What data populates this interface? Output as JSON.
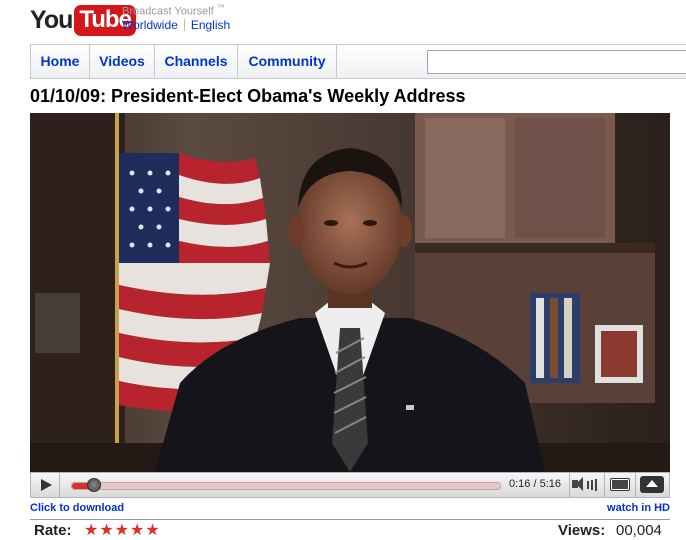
{
  "header": {
    "logo_you": "You",
    "logo_tube": "Tube",
    "tagline": "Broadcast Yourself",
    "tagline_mark": "™",
    "locale_region": "Worldwide",
    "locale_language": "English"
  },
  "nav": {
    "tabs": [
      {
        "label": "Home"
      },
      {
        "label": "Videos"
      },
      {
        "label": "Channels"
      },
      {
        "label": "Community"
      }
    ],
    "search_value": ""
  },
  "video": {
    "title": "01/10/09: President-Elect Obama's Weekly Address",
    "progress_fraction": 0.051,
    "time_display": "0:16 / 5:16",
    "download_link": "Click to download",
    "hd_link": "watch in HD"
  },
  "stats": {
    "rate_label": "Rate:",
    "stars": "★★★★★",
    "views_label": "Views:",
    "views_value": "00,004"
  },
  "colors": {
    "brand_red": "#d5161b",
    "link_blue": "#0033cc",
    "progress_red": "#d63031"
  },
  "icons": [
    "play-icon",
    "volume-icon",
    "screen-size-icon",
    "fullscreen-icon"
  ]
}
